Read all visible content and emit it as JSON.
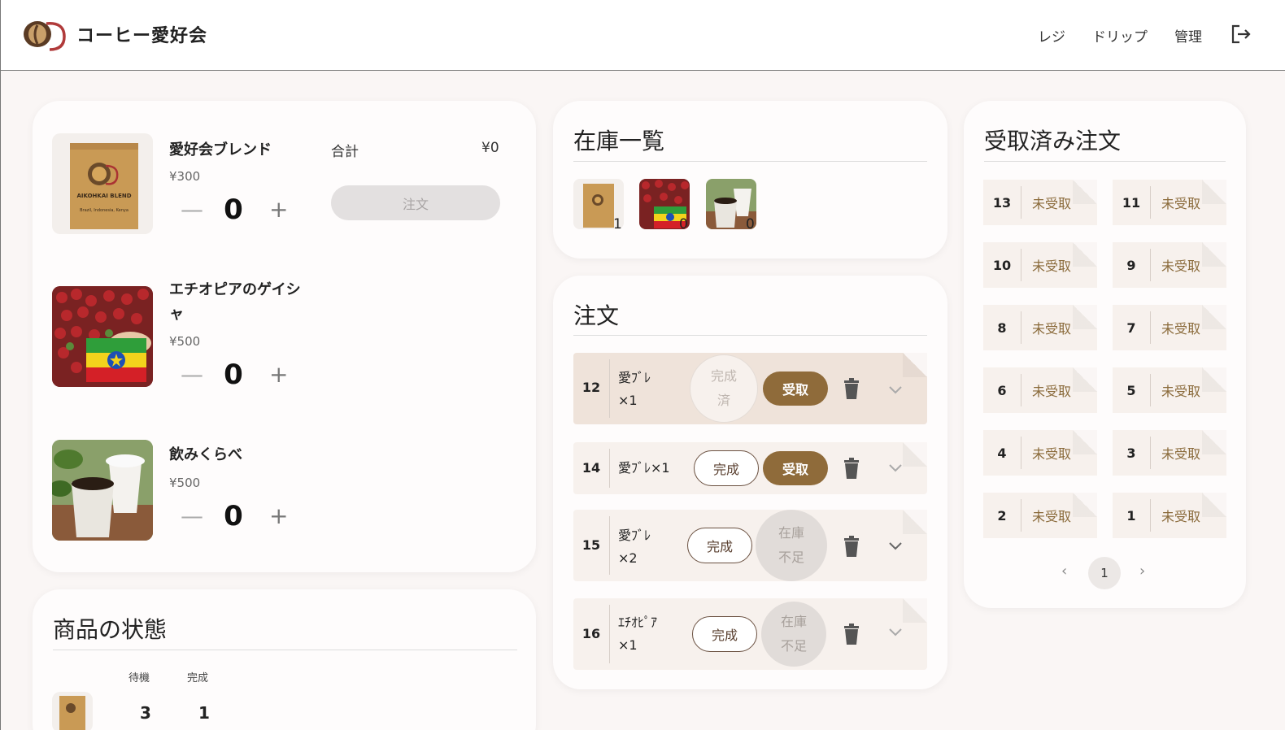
{
  "header": {
    "app_title": "コーヒー愛好会",
    "nav": {
      "register": "レジ",
      "drip": "ドリップ",
      "admin": "管理"
    }
  },
  "products": [
    {
      "name": "愛好会ブレンド",
      "price": "¥300",
      "qty": "0"
    },
    {
      "name": "エチオピアのゲイシャ",
      "price": "¥500",
      "qty": "0"
    },
    {
      "name": "飲みくらべ",
      "price": "¥500",
      "qty": "0"
    }
  ],
  "bag_label": "AIKOHKAI BLEND",
  "bag_sub": "Brazil, Indonesia, Kenya",
  "cart": {
    "total_label": "合計",
    "total_value": "¥0",
    "order_button": "注文"
  },
  "controls": {
    "minus": "—",
    "plus": "+"
  },
  "status_panel": {
    "title": "商品の状態",
    "col_waiting": "待機",
    "col_done": "完成",
    "rows": [
      {
        "waiting": "3",
        "done": "1"
      }
    ]
  },
  "stock": {
    "title": "在庫一覧",
    "items": [
      {
        "count": "1"
      },
      {
        "count": "0"
      },
      {
        "count": "0"
      }
    ]
  },
  "orders": {
    "title": "注文",
    "rows": [
      {
        "num": "12",
        "item_line1": "愛ﾌﾞﾚ",
        "item_line2": "×1",
        "done_line1": "完成",
        "done_line2": "済",
        "receive": "受取"
      },
      {
        "num": "14",
        "item_line1": "愛ﾌﾞﾚ×1",
        "done": "完成",
        "receive": "受取"
      },
      {
        "num": "15",
        "item_line1": "愛ﾌﾞﾚ",
        "item_line2": "×2",
        "done": "完成",
        "nostock_line1": "在庫",
        "nostock_line2": "不足"
      },
      {
        "num": "16",
        "item_line1": "ｴﾁｵﾋﾟｱ",
        "item_line2": "×1",
        "done": "完成",
        "nostock_line1": "在庫",
        "nostock_line2": "不足"
      }
    ]
  },
  "received": {
    "title": "受取済み注文",
    "status_text": "未受取",
    "tiles": [
      {
        "num": "13"
      },
      {
        "num": "11"
      },
      {
        "num": "10"
      },
      {
        "num": "9"
      },
      {
        "num": "8"
      },
      {
        "num": "7"
      },
      {
        "num": "6"
      },
      {
        "num": "5"
      },
      {
        "num": "4"
      },
      {
        "num": "3"
      },
      {
        "num": "2"
      },
      {
        "num": "1"
      }
    ],
    "pagination": {
      "prev": "‹",
      "current": "1",
      "next": "›"
    }
  },
  "colors": {
    "accent": "#8f6b3a",
    "row_bg": "#f7f1ed",
    "row_highlight": "#efe3da"
  }
}
